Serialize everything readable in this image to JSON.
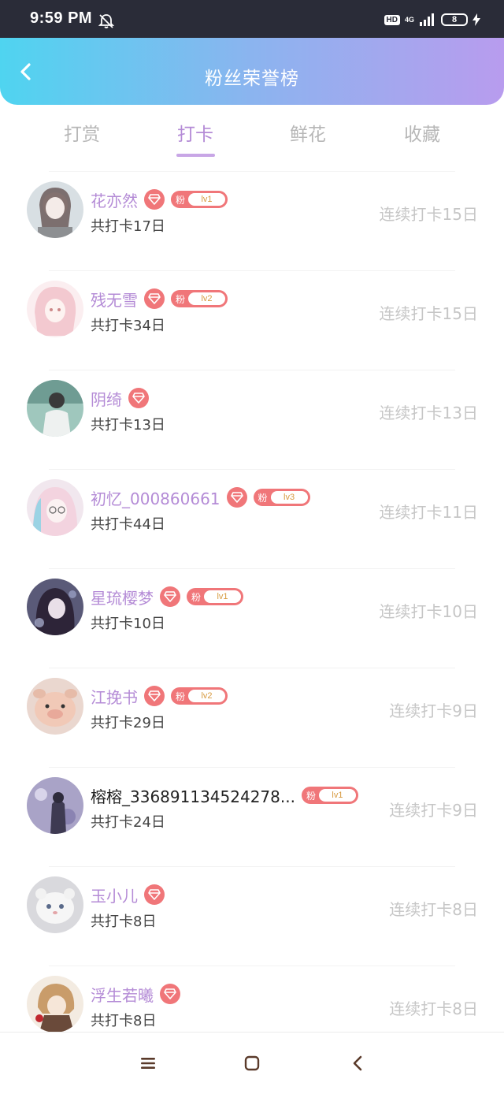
{
  "status": {
    "time": "9:59 PM",
    "hd": "HD",
    "network": "4G",
    "battery": "8"
  },
  "header": {
    "title": "粉丝荣誉榜"
  },
  "tabs": [
    {
      "label": "打赏",
      "active": false
    },
    {
      "label": "打卡",
      "active": true
    },
    {
      "label": "鲜花",
      "active": false
    },
    {
      "label": "收藏",
      "active": false
    }
  ],
  "rows": [
    {
      "name": "花亦然",
      "vip": true,
      "fan_label": "粉",
      "level": "lv1",
      "total": "共打卡17日",
      "streak": "连续打卡15日"
    },
    {
      "name": "残无雪",
      "vip": true,
      "fan_label": "粉",
      "level": "lv2",
      "total": "共打卡34日",
      "streak": "连续打卡15日"
    },
    {
      "name": "阴绮",
      "vip": true,
      "fan_label": "",
      "level": "",
      "total": "共打卡13日",
      "streak": "连续打卡13日"
    },
    {
      "name": "初忆_000860661",
      "vip": true,
      "fan_label": "粉",
      "level": "lv3",
      "total": "共打卡44日",
      "streak": "连续打卡11日"
    },
    {
      "name": "星琉樱梦",
      "vip": true,
      "fan_label": "粉",
      "level": "lv1",
      "total": "共打卡10日",
      "streak": "连续打卡10日"
    },
    {
      "name": "江挽书",
      "vip": true,
      "fan_label": "粉",
      "level": "lv2",
      "total": "共打卡29日",
      "streak": "连续打卡9日"
    },
    {
      "name": "榕榕_336891134524278...",
      "vip": false,
      "fan_label": "粉",
      "level": "lv1",
      "total": "共打卡24日",
      "streak": "连续打卡9日"
    },
    {
      "name": "玉小儿",
      "vip": true,
      "fan_label": "",
      "level": "",
      "total": "共打卡8日",
      "streak": "连续打卡8日"
    },
    {
      "name": "浮生若曦",
      "vip": true,
      "fan_label": "",
      "level": "",
      "total": "共打卡8日",
      "streak": "连续打卡8日"
    }
  ],
  "icons": {
    "back": "chevron-left-icon",
    "vip": "diamond-icon",
    "nav_menu": "menu-icon",
    "nav_home": "square-home-icon",
    "nav_back": "back-triangle-icon"
  },
  "colors": {
    "accent": "#b48bd6",
    "badge": "#f07679",
    "header_start": "#4fd4f0",
    "header_end": "#b89cee"
  }
}
